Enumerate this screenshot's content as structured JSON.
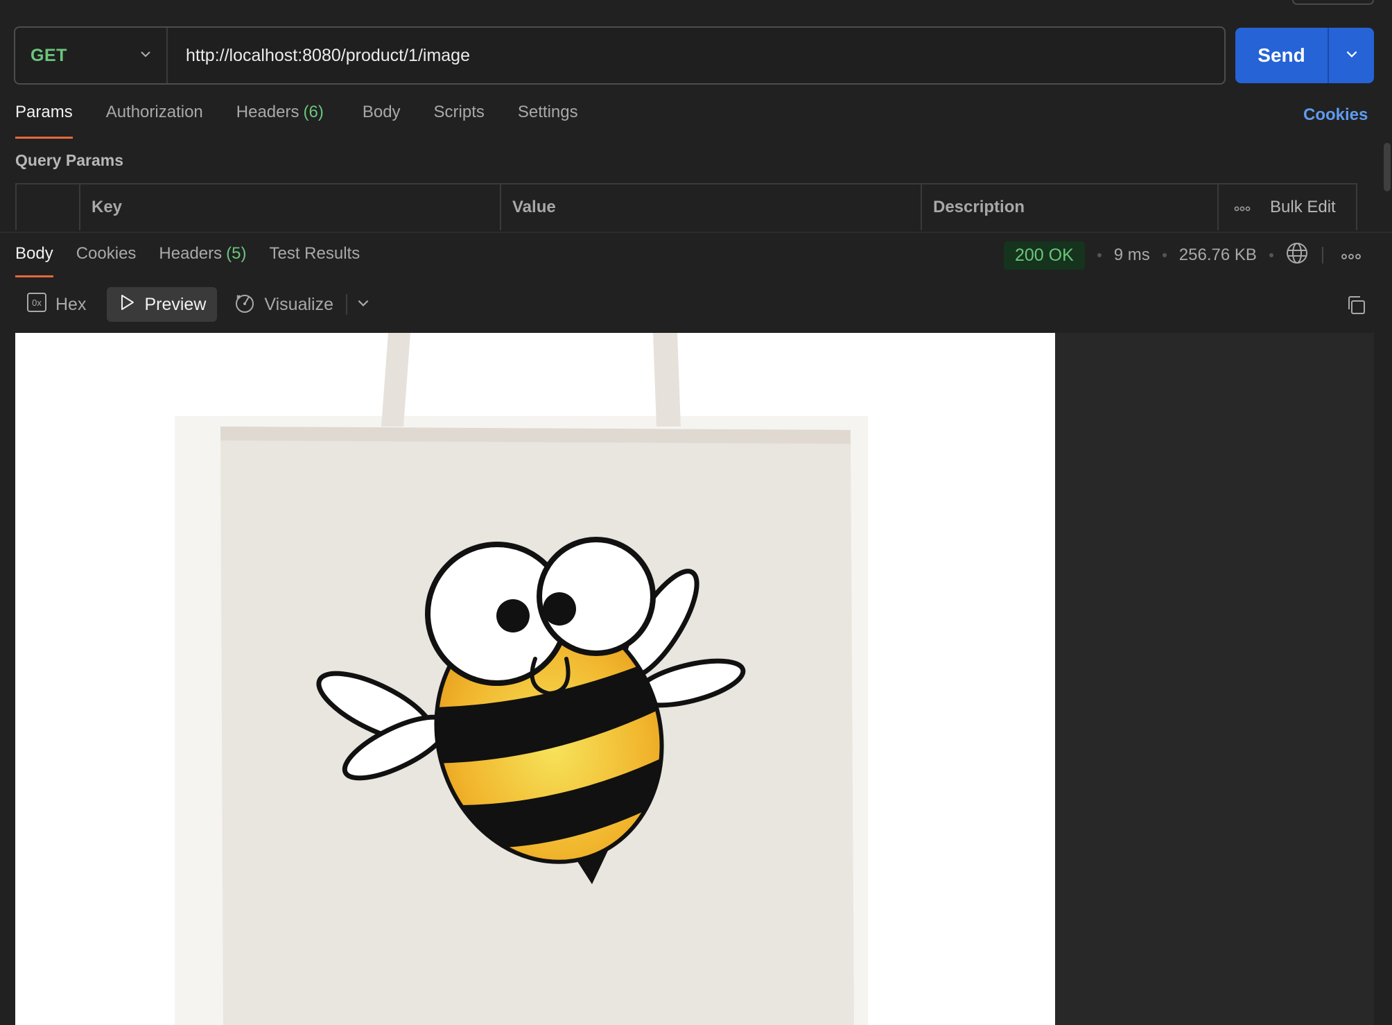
{
  "request": {
    "method": "GET",
    "url": "http://localhost:8080/product/1/image",
    "send_label": "Send"
  },
  "request_tabs": [
    {
      "label": "Params",
      "active": true
    },
    {
      "label": "Authorization"
    },
    {
      "label": "Headers",
      "count": "(6)"
    },
    {
      "label": "Body"
    },
    {
      "label": "Scripts"
    },
    {
      "label": "Settings"
    }
  ],
  "cookies_link": "Cookies",
  "query_params": {
    "title": "Query Params",
    "columns": [
      "Key",
      "Value",
      "Description"
    ],
    "bulk_edit": "Bulk Edit"
  },
  "response_tabs": [
    {
      "label": "Body",
      "active": true
    },
    {
      "label": "Cookies"
    },
    {
      "label": "Headers",
      "count": "(5)"
    },
    {
      "label": "Test Results"
    }
  ],
  "response_status": {
    "status": "200 OK",
    "time": "9 ms",
    "size": "256.76 KB"
  },
  "preview_toolbar": {
    "hex_label": "Hex",
    "hex_icon_text": "0x",
    "preview_label": "Preview",
    "visualize_label": "Visualize",
    "active": "Preview"
  },
  "preview": {
    "image_subject": "tote bag with cartoon bee print"
  },
  "colors": {
    "accent_blue": "#2563d6",
    "method_green": "#6cc57c",
    "tab_underline": "#e8683c",
    "link_blue": "#5f9bf0"
  },
  "icons": [
    "chevron-down-icon",
    "play-icon",
    "visualize-icon",
    "globe-icon",
    "more-icon",
    "copy-icon",
    "hex-icon"
  ]
}
